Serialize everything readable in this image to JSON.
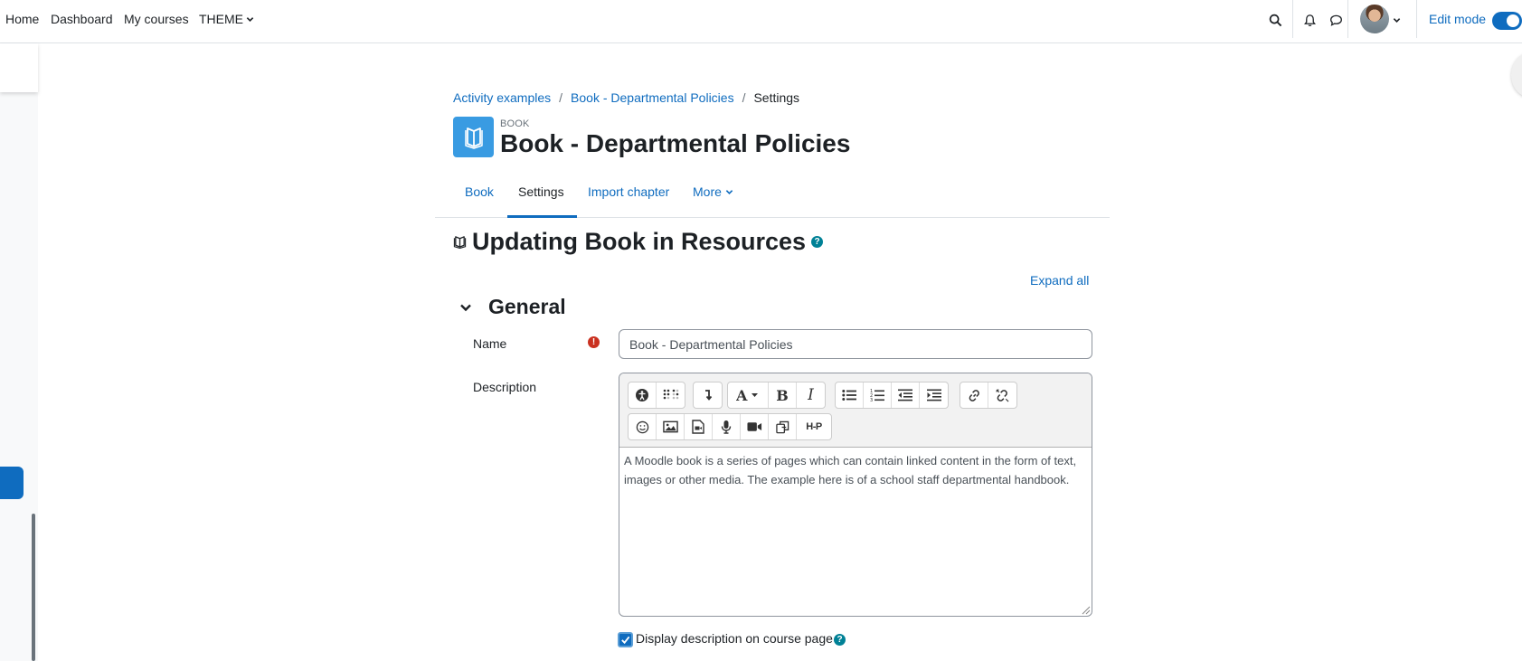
{
  "nav": {
    "home": "Home",
    "dashboard": "Dashboard",
    "my_courses": "My courses",
    "theme": "THEME",
    "edit_mode": "Edit mode"
  },
  "breadcrumb": {
    "items": [
      "Activity examples",
      "Book - Departmental Policies"
    ],
    "current": "Settings",
    "separator": "/"
  },
  "module": {
    "type": "BOOK",
    "title": "Book - Departmental Policies"
  },
  "tabs": [
    {
      "label": "Book",
      "active": false
    },
    {
      "label": "Settings",
      "active": true
    },
    {
      "label": "Import chapter",
      "active": false
    },
    {
      "label": "More",
      "active": false
    }
  ],
  "heading": "Updating Book in Resources",
  "expand_all": "Expand all",
  "section": {
    "title": "General"
  },
  "form": {
    "name_label": "Name",
    "name_value": "Book - Departmental Policies",
    "description_label": "Description",
    "description_text": "A  Moodle book is a series of pages which can contain linked content  in the form of text, images or other media. The example here is of a school staff departmental handbook.",
    "display_description_label": "Display description on course page",
    "display_description_checked": true
  },
  "colors": {
    "primary": "#0f6cbf",
    "module_icon_bg": "#399be2",
    "help": "#008196",
    "required": "#ca3120"
  },
  "icons": {
    "toolbar_row1": [
      "accessibility-icon",
      "screenreader-icon",
      "collapse-icon",
      "font-icon",
      "bold-icon",
      "italic-icon",
      "unordered-list-icon",
      "ordered-list-icon",
      "outdent-icon",
      "indent-icon",
      "link-icon",
      "unlink-icon"
    ],
    "toolbar_row2": [
      "emoji-icon",
      "image-icon",
      "media-icon",
      "record-audio-icon",
      "record-video-icon",
      "manage-files-icon",
      "h5p-icon"
    ]
  },
  "toolbar_labels": {
    "bold": "B",
    "italic": "I",
    "h5p": "H-P"
  }
}
